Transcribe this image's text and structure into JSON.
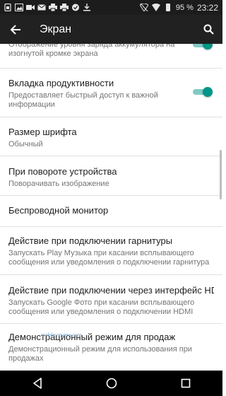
{
  "status_bar": {
    "icons": [
      "sim-icon",
      "image-icon",
      "video-icon",
      "mail-icon",
      "print-icon",
      "print-icon",
      "circle-icon",
      "download-icon",
      "wifi-off-icon",
      "wifi-icon",
      "battery-icon"
    ],
    "battery": "95 %",
    "time": "23:22"
  },
  "app_bar": {
    "title": "Экран",
    "back_icon": "arrow-back-icon",
    "search_icon": "search-icon"
  },
  "settings": [
    {
      "title": "",
      "subtitle": "Отображение уровня заряда аккумулятора на изогнутой кромке экрана",
      "toggle": true
    },
    {
      "title": "Вкладка продуктивности",
      "subtitle": "Предоставляет быстрый доступ к важной информации",
      "toggle": true
    },
    {
      "title": "Размер шрифта",
      "subtitle": "Обычный"
    },
    {
      "title": "При повороте устройства",
      "subtitle": "Поворачивать изображение"
    },
    {
      "title": "Беспроводной монитор",
      "subtitle": ""
    },
    {
      "title": "Действие при подключении гарнитуры",
      "subtitle": "Запускать Play Музыка при касании всплывающего сообщения или уведомления о подключении гарнитура"
    },
    {
      "title": "Действие при подключении через интерфейс HD..",
      "subtitle": "Запускать Google Фото при касании всплывающего сообщения или уведомления о подключении HDMI"
    },
    {
      "title": "Демонстрационный режим для продаж",
      "subtitle": "Демонстрационный режим для использования при продажах"
    }
  ],
  "watermark": "mobile-review.com",
  "nav_bar": {
    "back_icon": "nav-back-icon",
    "home_icon": "nav-home-icon",
    "recents_icon": "nav-recents-icon"
  },
  "colors": {
    "accent": "#009688",
    "accent_track": "#80cbc4",
    "app_bar": "#212121",
    "status_bar": "#1c1c1c"
  }
}
